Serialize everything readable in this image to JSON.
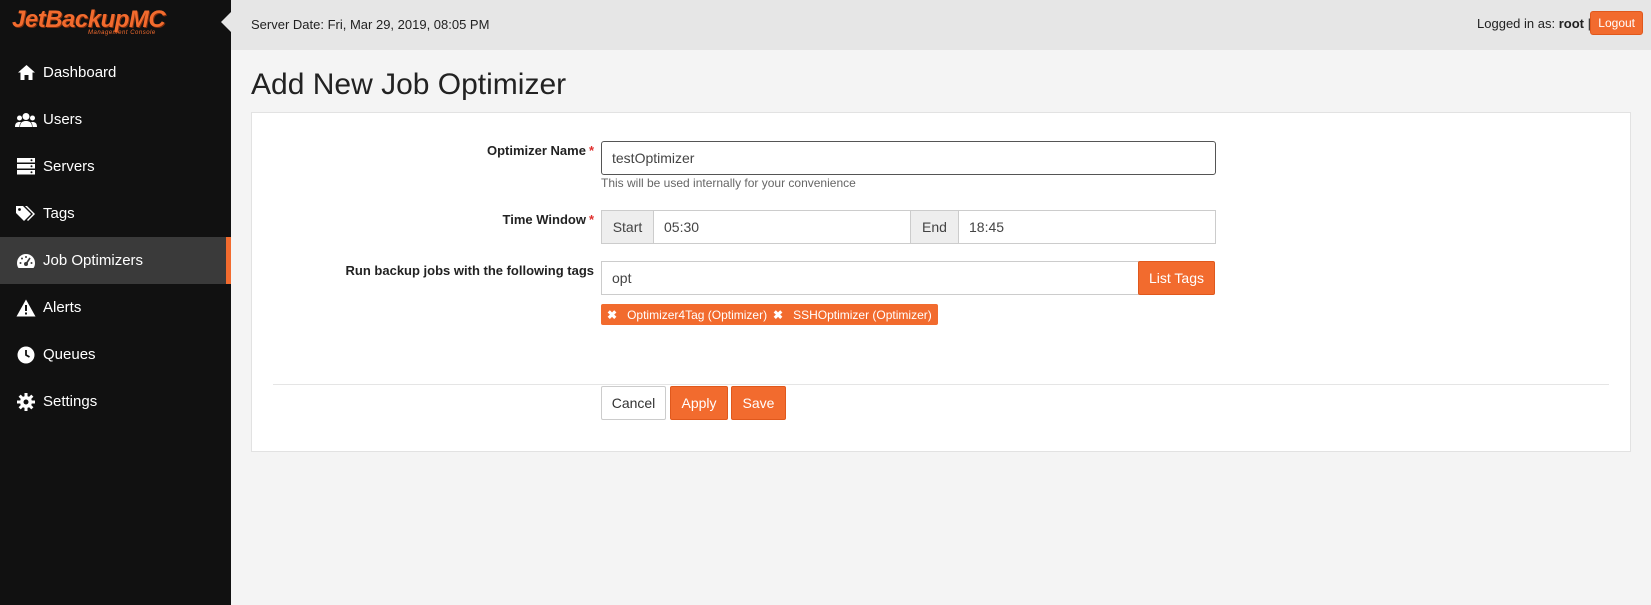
{
  "app": {
    "logo_text": "JetBackupMC",
    "logo_subtitle": "Management Console"
  },
  "sidebar": {
    "items": [
      {
        "label": "Dashboard",
        "icon": "home-icon"
      },
      {
        "label": "Users",
        "icon": "users-icon"
      },
      {
        "label": "Servers",
        "icon": "servers-icon"
      },
      {
        "label": "Tags",
        "icon": "tags-icon"
      },
      {
        "label": "Job Optimizers",
        "icon": "gauge-icon",
        "active": true
      },
      {
        "label": "Alerts",
        "icon": "warning-icon"
      },
      {
        "label": "Queues",
        "icon": "clock-icon"
      },
      {
        "label": "Settings",
        "icon": "gear-icon"
      }
    ]
  },
  "topbar": {
    "server_date": "Server Date: Fri, Mar 29, 2019, 08:05 PM",
    "logged_prefix": "Logged in as: ",
    "username": "root",
    "separator": " |",
    "logout_label": "Logout"
  },
  "page": {
    "title": "Add New Job Optimizer"
  },
  "form": {
    "name_label": "Optimizer Name",
    "name_value": "testOptimizer",
    "name_help": "This will be used internally for your convenience",
    "time_label": "Time Window",
    "start_label": "Start",
    "start_value": "05:30",
    "end_label": "End",
    "end_value": "18:45",
    "tags_label": "Run backup jobs with the following tags",
    "tags_input_value": "opt",
    "list_tags_label": "List Tags",
    "selected_tags": [
      "Optimizer4Tag (Optimizer)",
      "SSHOptimizer (Optimizer)"
    ],
    "required_mark": "*"
  },
  "actions": {
    "cancel_label": "Cancel",
    "apply_label": "Apply",
    "save_label": "Save"
  },
  "colors": {
    "accent": "#f26b2e",
    "sidebar_bg": "#111111",
    "topbar_bg": "#e6e6e6"
  }
}
